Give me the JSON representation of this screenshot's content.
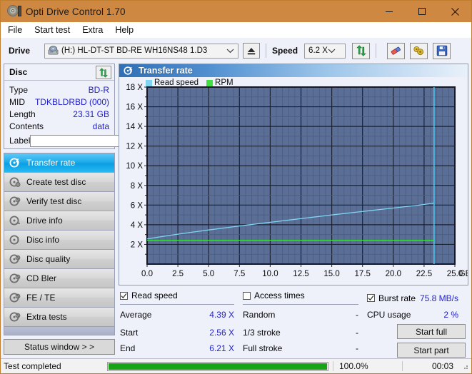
{
  "window": {
    "title": "Opti Drive Control 1.70",
    "app_icon": "disc-icon",
    "minimize": "minimize-icon",
    "maximize": "maximize-icon",
    "close": "close-icon",
    "titlebar_color": "#cf8841"
  },
  "menu": {
    "items": [
      {
        "label": "File"
      },
      {
        "label": "Start test"
      },
      {
        "label": "Extra"
      },
      {
        "label": "Help"
      }
    ]
  },
  "toolbar": {
    "drive_label": "Drive",
    "drive_value": "(H:)  HL-DT-ST BD-RE  WH16NS48 1.D3",
    "drive_icon": "drive-icon",
    "eject_icon": "eject-icon",
    "speed_label": "Speed",
    "speed_value": "6.2 X",
    "refresh_icon": "refresh-icon",
    "eraser_icon": "eraser-icon",
    "tools_icon": "tools-icon",
    "save_icon": "save-icon"
  },
  "disc": {
    "header": "Disc",
    "refresh_icon": "refresh-icon",
    "fields": [
      {
        "key": "Type",
        "value": "BD-R"
      },
      {
        "key": "MID",
        "value": "TDKBLDRBD (000)"
      },
      {
        "key": "Length",
        "value": "23.31 GB"
      },
      {
        "key": "Contents",
        "value": "data"
      }
    ],
    "label_key": "Label",
    "label_value": "",
    "label_placeholder": "",
    "cd_icon": "cd-icon"
  },
  "nav": {
    "items": [
      {
        "label": "Transfer rate",
        "icon": "disc-test-icon",
        "selected": true
      },
      {
        "label": "Create test disc",
        "icon": "disc-test-icon",
        "selected": false
      },
      {
        "label": "Verify test disc",
        "icon": "disc-test-icon",
        "selected": false
      },
      {
        "label": "Drive info",
        "icon": "disc-test-icon",
        "selected": false
      },
      {
        "label": "Disc info",
        "icon": "disc-test-icon",
        "selected": false
      },
      {
        "label": "Disc quality",
        "icon": "disc-test-icon",
        "selected": false
      },
      {
        "label": "CD Bler",
        "icon": "disc-test-icon",
        "selected": false
      },
      {
        "label": "FE / TE",
        "icon": "disc-test-icon",
        "selected": false
      },
      {
        "label": "Extra tests",
        "icon": "disc-test-icon",
        "selected": false
      }
    ],
    "status_window_label": "Status window > >"
  },
  "panel": {
    "title": "Transfer rate",
    "icon": "disc-test-icon"
  },
  "chart_data": {
    "type": "line",
    "title": "Transfer rate",
    "xlabel": "GB",
    "ylabel": "X",
    "xlim": [
      0.0,
      25.0
    ],
    "ylim": [
      0,
      18
    ],
    "xticks": [
      "0.0",
      "2.5",
      "5.0",
      "7.5",
      "10.0",
      "12.5",
      "15.0",
      "17.5",
      "20.0",
      "22.5",
      "25.0"
    ],
    "xtick_values": [
      0.0,
      2.5,
      5.0,
      7.5,
      10.0,
      12.5,
      15.0,
      17.5,
      20.0,
      22.5,
      25.0
    ],
    "x_unit_label": "GB",
    "yticks": [
      "2 X",
      "4 X",
      "6 X",
      "8 X",
      "10 X",
      "12 X",
      "14 X",
      "16 X",
      "18 X"
    ],
    "ytick_values": [
      2,
      4,
      6,
      8,
      10,
      12,
      14,
      16,
      18
    ],
    "grid": true,
    "plot_bg": "#5b6f96",
    "legend_position": "top-left",
    "legend": [
      {
        "name": "Read speed",
        "color": "#7fd4f2"
      },
      {
        "name": "RPM",
        "color": "#3fe03f"
      }
    ],
    "series": [
      {
        "name": "Read speed",
        "color": "#7fd4f2",
        "x": [
          0.0,
          1.0,
          2.0,
          3.0,
          4.0,
          5.0,
          6.0,
          7.0,
          8.0,
          9.0,
          10.0,
          11.0,
          12.0,
          13.0,
          14.0,
          15.0,
          16.0,
          17.0,
          18.0,
          19.0,
          20.0,
          21.0,
          22.0,
          23.0,
          23.31
        ],
        "values": [
          2.56,
          2.76,
          2.95,
          3.13,
          3.3,
          3.47,
          3.63,
          3.79,
          3.95,
          4.1,
          4.25,
          4.4,
          4.55,
          4.7,
          4.85,
          5.0,
          5.14,
          5.28,
          5.42,
          5.56,
          5.7,
          5.84,
          5.98,
          6.15,
          6.21
        ]
      },
      {
        "name": "RPM",
        "color": "#3fe03f",
        "x": [
          0.0,
          5.0,
          10.0,
          15.0,
          20.0,
          23.31
        ],
        "values": [
          2.42,
          2.42,
          2.42,
          2.42,
          2.42,
          2.42
        ]
      }
    ],
    "markers": [
      {
        "name": "disc-end-marker",
        "x": 23.31,
        "color": "#3fc8f5"
      }
    ]
  },
  "stats": {
    "read_speed": {
      "checkbox_label": "Read speed",
      "checked": true,
      "rows": [
        {
          "key": "Average",
          "value": "4.39 X"
        },
        {
          "key": "Start",
          "value": "2.56 X"
        },
        {
          "key": "End",
          "value": "6.21 X"
        }
      ]
    },
    "access_times": {
      "checkbox_label": "Access times",
      "checked": false,
      "rows": [
        {
          "key": "Random",
          "value": "-"
        },
        {
          "key": "1/3 stroke",
          "value": "-"
        },
        {
          "key": "Full stroke",
          "value": "-"
        }
      ]
    },
    "burst_rate": {
      "checkbox_label": "Burst rate",
      "checked": true,
      "value": "75.8 MB/s",
      "cpu_key": "CPU usage",
      "cpu_value": "2 %"
    },
    "buttons": [
      {
        "label": "Start full"
      },
      {
        "label": "Start part"
      }
    ]
  },
  "statusbar": {
    "text": "Test completed",
    "progress_percent": 100.0,
    "progress_label": "100.0%",
    "elapsed": "00:03",
    "progress_color": "#17a317",
    "grip_icon": "resize-grip-icon"
  }
}
